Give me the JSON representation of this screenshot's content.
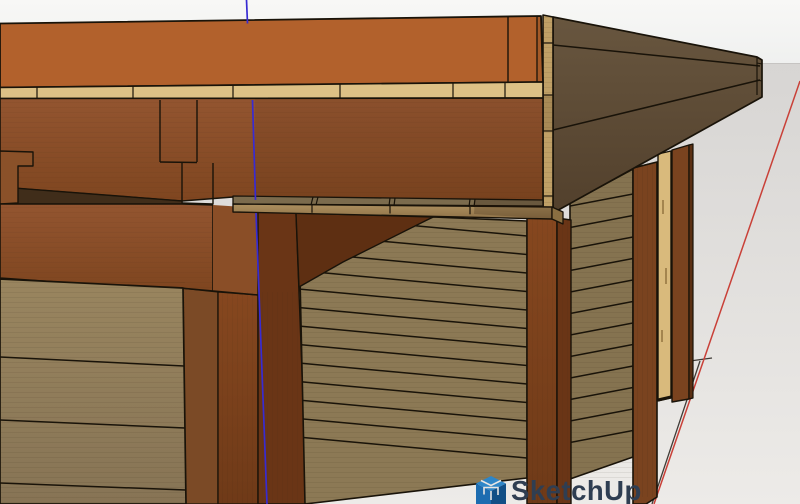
{
  "app": {
    "name": "SketchUp",
    "view": "3d-viewport"
  },
  "watermark": {
    "text": "SketchUp"
  },
  "axes": {
    "blue_axis_color": "#382bd2",
    "red_axis_color": "#c94038"
  },
  "palette": {
    "edge": "#191309",
    "sky_top": "#f8f8f6",
    "sky_bottom": "#eff0ef",
    "ground_top": "#d7d5d3",
    "ground_bottom": "#edebe8",
    "horizon": "#c6c4c2",
    "roof_top": "#b2612c",
    "fascia_strip": "#ddc186",
    "ply_corner": "#c0a066",
    "fascia_side": "#5d4b36",
    "beam_upper": "#8d5129",
    "beam_mid": "#8a4e27",
    "slot_dark": "#402d1a",
    "post_front": "#7d421e",
    "post_right": "#6a3516",
    "wedge_dark": "#5e2f12",
    "wall_planks": "#8f7c5b",
    "slat_wall": "#8c7955",
    "slat_wall_right": "#857350",
    "shelf_top": "#7b6b4d",
    "shelf_edge": "#a18455",
    "shelf_return": "#8a6f42",
    "post_a": "#7a431f",
    "tan_board": "#d9ba7c",
    "post_b_side": "#5b3013",
    "ground_line": "#403c37",
    "wm_text": "#2f3e52",
    "wm_blue_light": "#2e86c8",
    "wm_blue_mid": "#1c6cb0",
    "wm_blue_dark": "#114f86"
  }
}
